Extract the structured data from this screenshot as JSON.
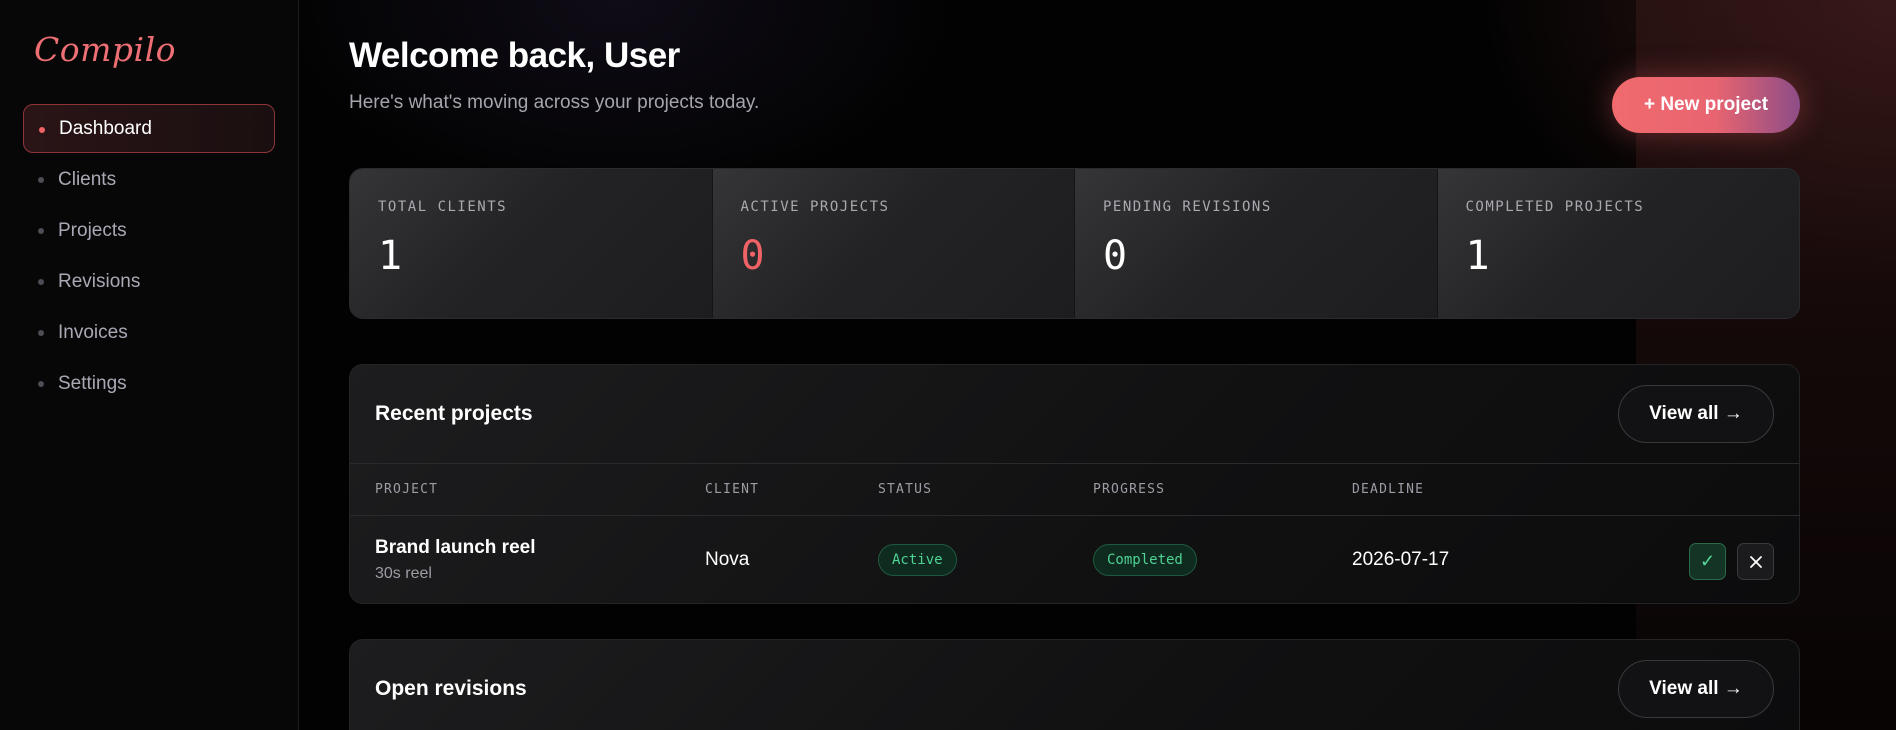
{
  "sidebar": {
    "logo": "Compilo",
    "items": [
      {
        "label": "Dashboard",
        "active": true
      },
      {
        "label": "Clients",
        "active": false
      },
      {
        "label": "Projects",
        "active": false
      },
      {
        "label": "Revisions",
        "active": false
      },
      {
        "label": "Invoices",
        "active": false
      },
      {
        "label": "Settings",
        "active": false
      }
    ]
  },
  "header": {
    "title": "Welcome back, User",
    "subtitle": "Here's what's moving across your projects today.",
    "new_project_label": "+ New project"
  },
  "stats": [
    {
      "label": "TOTAL CLIENTS",
      "value": "1"
    },
    {
      "label": "ACTIVE PROJECTS",
      "value": "0"
    },
    {
      "label": "PENDING REVISIONS",
      "value": "0"
    },
    {
      "label": "COMPLETED PROJECTS",
      "value": "1"
    }
  ],
  "recent_projects": {
    "title": "Recent projects",
    "view_all_label": "View all →",
    "columns": [
      "PROJECT",
      "CLIENT",
      "STATUS",
      "PROGRESS",
      "DEADLINE"
    ],
    "rows": [
      {
        "project": "Brand launch reel",
        "subtitle": "30s reel",
        "client": "Nova",
        "status": "Active",
        "progress": "Completed",
        "deadline": "2026-07-17"
      }
    ]
  },
  "open_revisions": {
    "title": "Open revisions",
    "view_all_label": "View all →"
  },
  "icons": {
    "approve": "check-icon",
    "dismiss": "close-icon"
  },
  "colors": {
    "accent": "#ef6266",
    "success": "#4fd394"
  }
}
